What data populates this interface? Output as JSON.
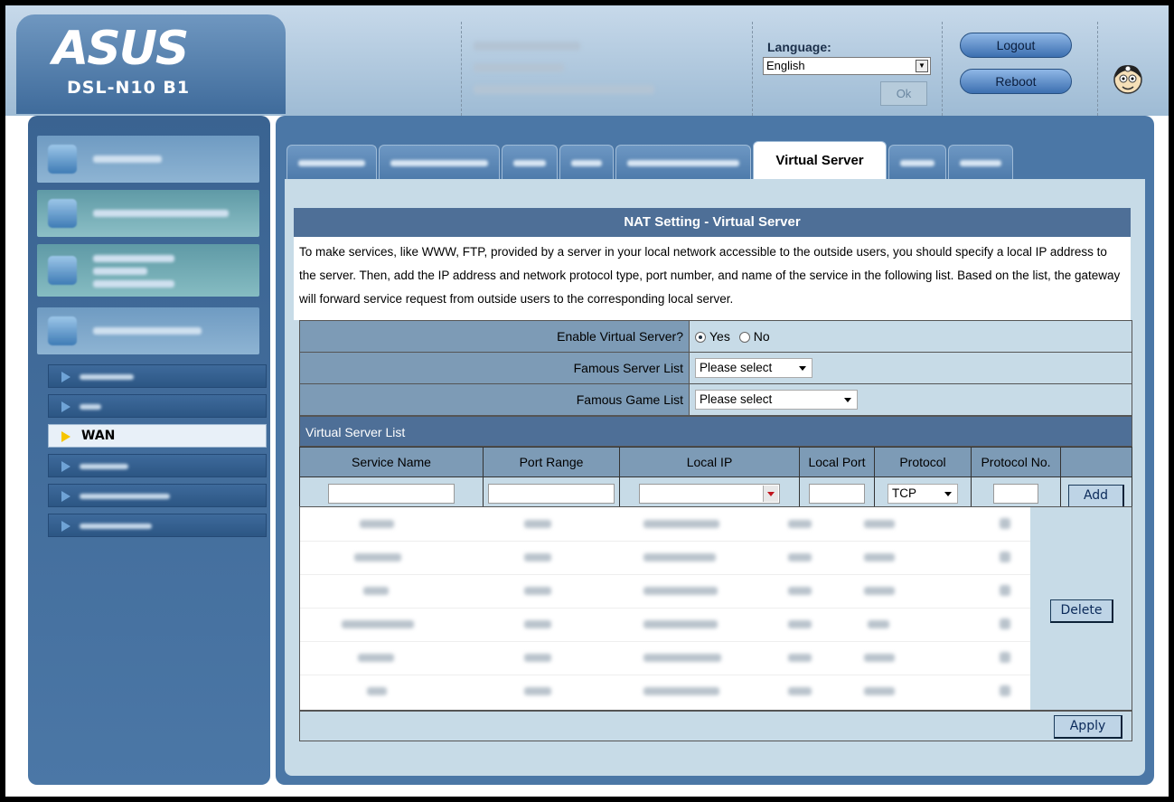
{
  "header": {
    "brand": "ASUS",
    "model": "DSL-N10 B1",
    "language_label": "Language:",
    "language_value": "English",
    "ok_label": "Ok",
    "logout_label": "Logout",
    "reboot_label": "Reboot"
  },
  "nav": {
    "active_submenu": "WAN"
  },
  "tabs": {
    "active": "Virtual Server"
  },
  "section": {
    "title": "NAT Setting - Virtual Server",
    "description": "To make services, like WWW, FTP, provided by a server in your local network accessible to the outside users, you should specify a local IP address to the server. Then, add the IP address and network protocol type, port number, and name of the service in the following list. Based on the list, the gateway will forward service request from outside users to the corresponding local server."
  },
  "form": {
    "enable_label": "Enable Virtual Server?",
    "yes_label": "Yes",
    "no_label": "No",
    "enable_value": "Yes",
    "famous_server_label": "Famous Server List",
    "famous_server_value": "Please select",
    "famous_game_label": "Famous Game List",
    "famous_game_value": "Please select"
  },
  "vs_list": {
    "title": "Virtual Server List",
    "columns": [
      "Service Name",
      "Port Range",
      "Local IP",
      "Local Port",
      "Protocol",
      "Protocol No."
    ],
    "protocol_value": "TCP",
    "add_label": "Add",
    "delete_label": "Delete",
    "apply_label": "Apply"
  },
  "colors": {
    "header_blue": "#4e6f97",
    "panel_blue": "#4b77a6",
    "content_bg": "#c7dbe7",
    "label_bg": "#7d9bb6"
  }
}
